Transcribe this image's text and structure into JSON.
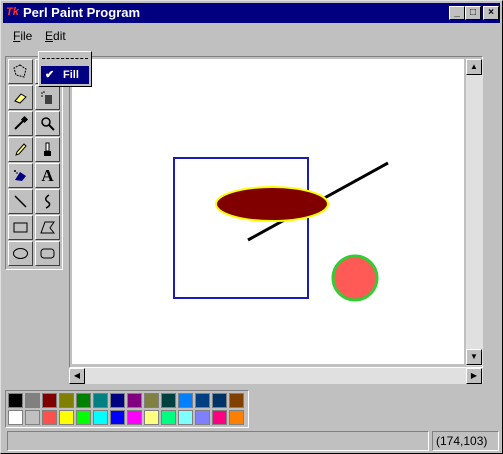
{
  "window": {
    "title": "Perl Paint Program",
    "tk_badge": "Tk",
    "buttons": [
      "_",
      "□",
      "×"
    ]
  },
  "menubar": {
    "items": [
      {
        "mnemonic": "F",
        "rest": "ile"
      },
      {
        "mnemonic": "E",
        "rest": "dit"
      }
    ]
  },
  "edit_menu": {
    "fill_checked": true,
    "fill_label": "Fill"
  },
  "tools": [
    {
      "name": "lasso-select",
      "icon": "select-icon"
    },
    {
      "name": "fill-bucket",
      "icon": "paint-bucket-icon"
    },
    {
      "name": "eraser",
      "icon": "eraser-icon"
    },
    {
      "name": "spray",
      "icon": "spray-can-icon"
    },
    {
      "name": "eyedropper",
      "icon": "eyedropper-icon"
    },
    {
      "name": "magnifier",
      "icon": "magnifier-icon"
    },
    {
      "name": "pencil",
      "icon": "pencil-icon"
    },
    {
      "name": "brush",
      "icon": "brush-icon"
    },
    {
      "name": "airbrush",
      "icon": "airbrush-icon"
    },
    {
      "name": "text",
      "icon": "text-icon",
      "glyph": "A"
    },
    {
      "name": "line",
      "icon": "line-icon"
    },
    {
      "name": "curve",
      "icon": "curve-icon"
    },
    {
      "name": "rectangle",
      "icon": "rectangle-icon"
    },
    {
      "name": "polygon",
      "icon": "polygon-icon"
    },
    {
      "name": "ellipse",
      "icon": "ellipse-icon"
    },
    {
      "name": "rounded-rectangle",
      "icon": "rounded-rectangle-icon"
    }
  ],
  "canvas": {
    "shapes": [
      {
        "type": "rectangle",
        "stroke": "#1c1cb0",
        "fill": "none"
      },
      {
        "type": "line",
        "stroke": "#000000"
      },
      {
        "type": "ellipse",
        "stroke": "#ffff00",
        "fill": "#800000"
      },
      {
        "type": "circle",
        "stroke": "#33cc33",
        "fill": "#ff5a55"
      }
    ]
  },
  "palette": {
    "row1": [
      "#000000",
      "#808080",
      "#800000",
      "#808000",
      "#008000",
      "#008080",
      "#000080",
      "#800080",
      "#808040",
      "#004040",
      "#0080ff",
      "#004080",
      "#003366",
      "#804000"
    ],
    "row2": [
      "#ffffff",
      "#c0c0c0",
      "#ff5050",
      "#ffff00",
      "#00ff00",
      "#00ffff",
      "#0000ff",
      "#ff00ff",
      "#ffff80",
      "#00ff80",
      "#80ffff",
      "#8080ff",
      "#ff0080",
      "#ff8000"
    ]
  },
  "status": {
    "message": "",
    "coords": "(174,103)"
  }
}
